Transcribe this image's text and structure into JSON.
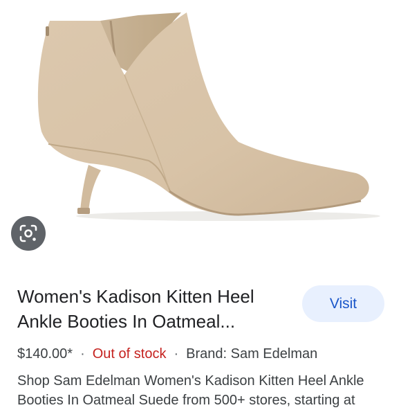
{
  "product": {
    "title": "Women's Kadison Kitten Heel Ankle Booties In Oatmeal...",
    "price": "$140.00*",
    "separator": "·",
    "stock_status": "Out of stock",
    "brand": "Brand: Sam Edelman",
    "description": "Shop Sam Edelman Women's Kadison Kitten Heel Ankle Booties In Oatmeal Suede from 500+ stores, starting at"
  },
  "actions": {
    "visit_label": "Visit",
    "lens_icon": "lens-search-icon"
  },
  "colors": {
    "boot_suede": "#d9c4a9",
    "stock_red": "#c5221f",
    "visit_blue": "#1a56c9",
    "visit_bg": "#e8f0fe"
  }
}
